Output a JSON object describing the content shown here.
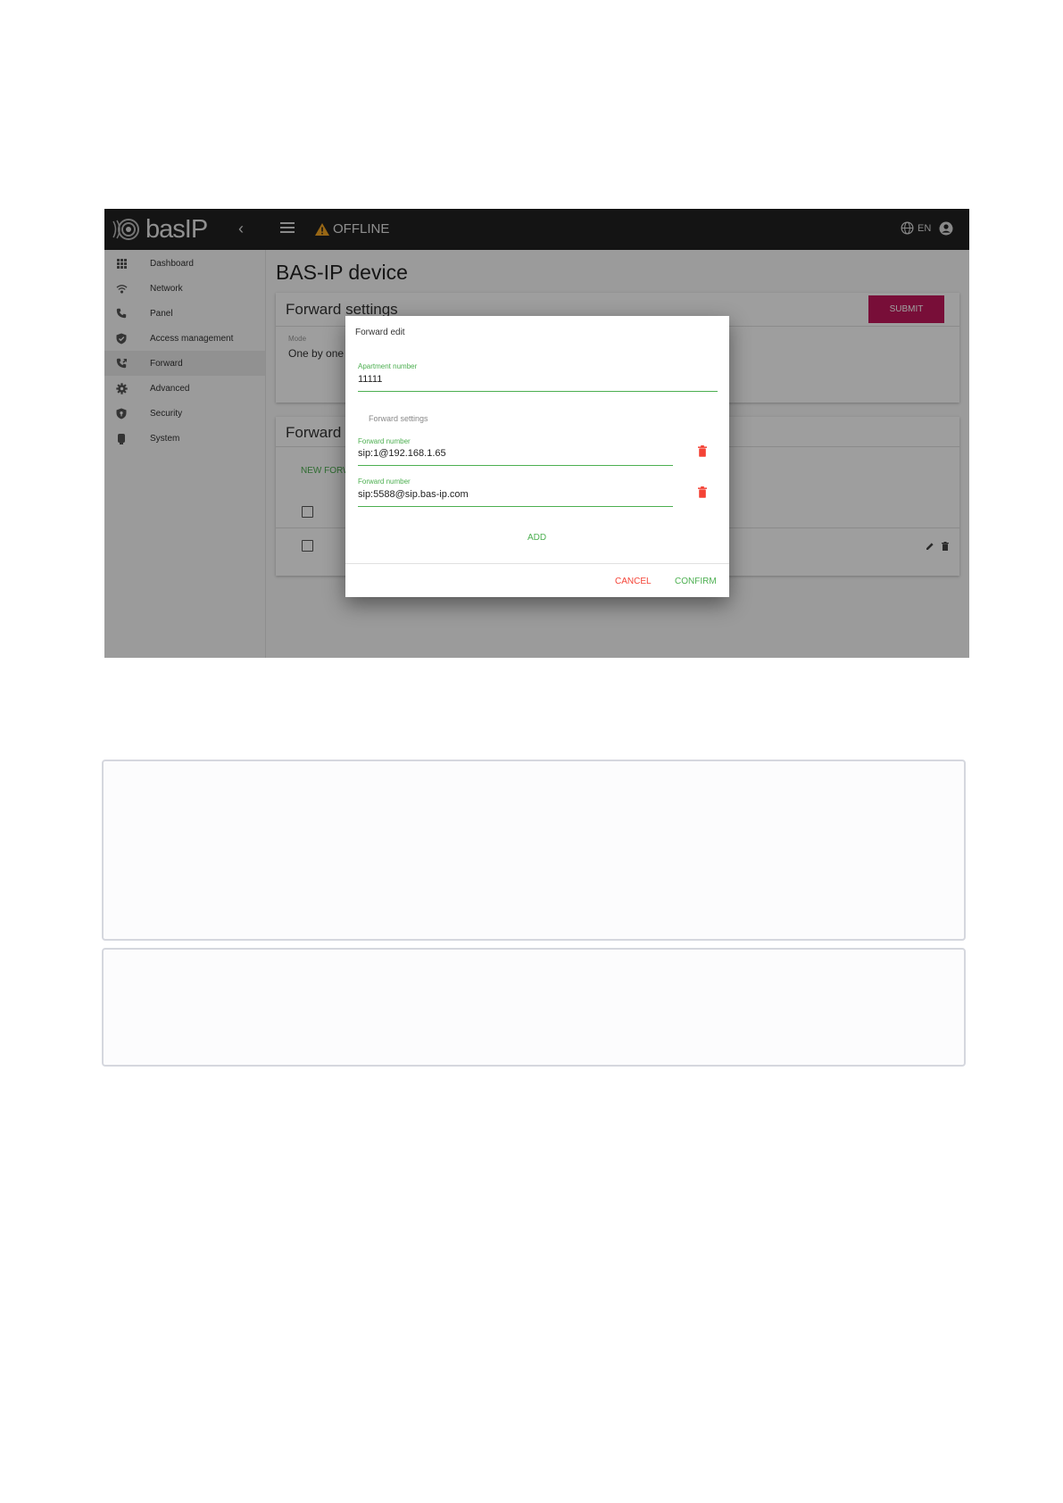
{
  "topbar": {
    "logo_text": "basIP",
    "status_text": "OFFLINE",
    "language": "EN"
  },
  "sidebar": {
    "items": [
      {
        "label": "Dashboard",
        "icon": "apps-grid-icon"
      },
      {
        "label": "Network",
        "icon": "wifi-icon"
      },
      {
        "label": "Panel",
        "icon": "phone-icon"
      },
      {
        "label": "Access management",
        "icon": "shield-check-icon"
      },
      {
        "label": "Forward",
        "icon": "phone-forward-icon",
        "active": true
      },
      {
        "label": "Advanced",
        "icon": "gear-icon"
      },
      {
        "label": "Security",
        "icon": "shield-lock-icon"
      },
      {
        "label": "System",
        "icon": "chip-icon"
      }
    ]
  },
  "main": {
    "page_title": "BAS-IP device",
    "forward_settings": {
      "title": "Forward settings",
      "submit_label": "SUBMIT",
      "mode_label": "Mode",
      "mode_value": "One by one"
    },
    "forward_list": {
      "title": "Forward",
      "new_button_label": "NEW FORW"
    }
  },
  "dialog": {
    "title": "Forward edit",
    "apartment": {
      "label": "Apartment number",
      "value": "11111"
    },
    "section_label": "Forward settings",
    "forward_numbers": [
      {
        "label": "Forward number",
        "value": "sip:1@192.168.1.65"
      },
      {
        "label": "Forward number",
        "value": "sip:5588@sip.bas-ip.com"
      }
    ],
    "add_label": "ADD",
    "cancel_label": "CANCEL",
    "confirm_label": "CONFIRM"
  },
  "colors": {
    "accent_green": "#4caf50",
    "submit_pink": "#c2185b",
    "delete_red": "#f44336",
    "warning_amber": "#f5a623",
    "topbar": "#212121"
  }
}
